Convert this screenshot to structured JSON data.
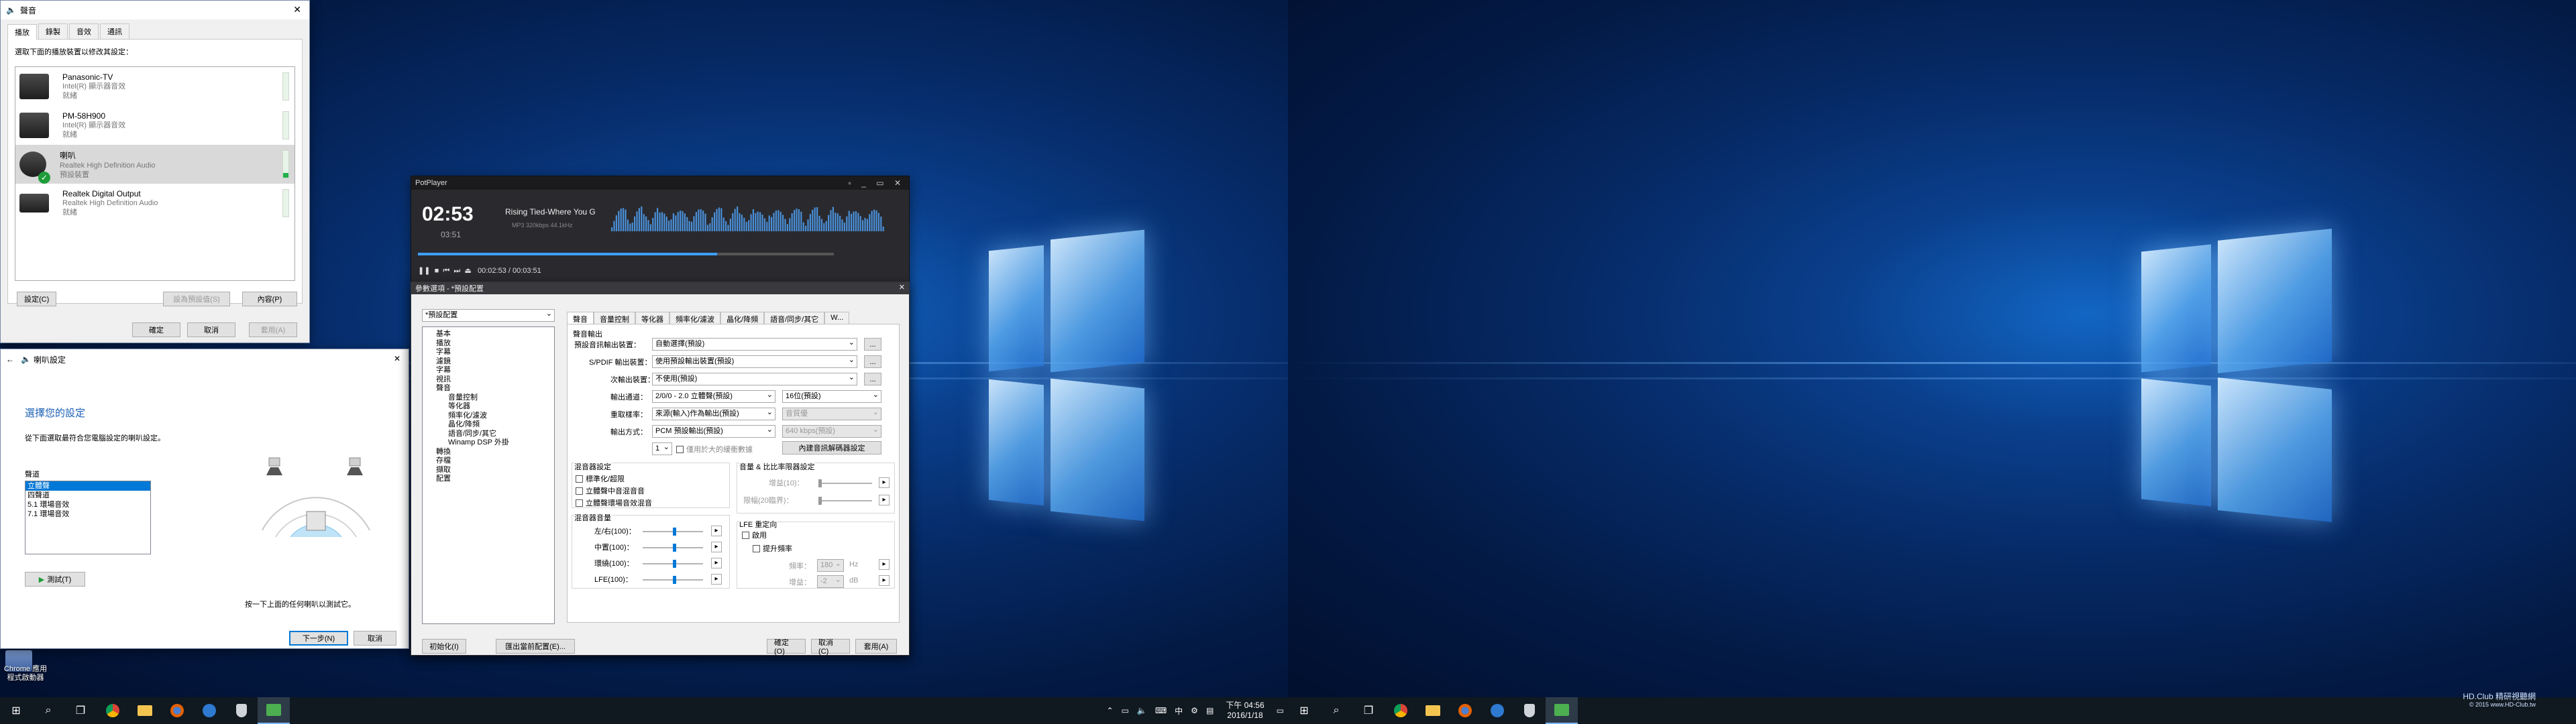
{
  "sound_dialog": {
    "title": "聲音",
    "tabs": [
      "播放",
      "錄製",
      "音效",
      "通訊"
    ],
    "instruction": "選取下面的播放裝置以修改其設定：",
    "devices": [
      {
        "name": "Panasonic-TV",
        "line1": "Intel(R) 顯示器音效",
        "line2": "就緒"
      },
      {
        "name": "PM-58H900",
        "line1": "Intel(R) 顯示器音效",
        "line2": "就緒"
      },
      {
        "name": "喇叭",
        "line1": "Realtek High Definition Audio",
        "line2": "預設裝置"
      },
      {
        "name": "Realtek Digital Output",
        "line1": "Realtek High Definition Audio",
        "line2": "就緒"
      }
    ],
    "configure_button": "設定(C)",
    "set_default_button": "設為預設值(S)",
    "properties_button": "內容(P)",
    "ok_button": "確定",
    "cancel_button": "取消",
    "apply_button": "套用(A)"
  },
  "speaker_setup": {
    "title": "喇叭設定",
    "heading": "選擇您的設定",
    "description": "從下面選取最符合您電腦設定的喇叭設定。",
    "channels_label": "聲道",
    "options": [
      "立體聲",
      "四聲道",
      "5.1 環場音效",
      "7.1 環場音效"
    ],
    "selected_index": 0,
    "test_button": "測試(T)",
    "hint": "按一下上面的任何喇叭以測試它。",
    "next_button": "下一步(N)",
    "cancel_button": "取消"
  },
  "potplayer": {
    "title": "PotPlayer",
    "elapsed": "02:53",
    "total": "03:51",
    "song_title": "Rising Tied-Where You G",
    "codec": "MP3   320kbps   44.1kHz",
    "status_time": "00:02:53 / 00:03:51",
    "seek_position": 0.72
  },
  "preferences": {
    "title": "參數選項 - *預設配置",
    "profile": "*預設配置",
    "tree": [
      {
        "label": "基本",
        "sub": false
      },
      {
        "label": "播放",
        "sub": false
      },
      {
        "label": "字幕",
        "sub": false
      },
      {
        "label": "濾鏡",
        "sub": false
      },
      {
        "label": "字幕",
        "sub": false
      },
      {
        "label": "視訊",
        "sub": false
      },
      {
        "label": "聲音",
        "sub": false
      },
      {
        "label": "音量控制",
        "sub": true
      },
      {
        "label": "等化器",
        "sub": true
      },
      {
        "label": "頻率化/濾波",
        "sub": true
      },
      {
        "label": "晶化/降頻",
        "sub": true
      },
      {
        "label": "語音/同步/其它",
        "sub": true
      },
      {
        "label": "Winamp DSP 外掛",
        "sub": true
      },
      {
        "label": "轉換",
        "sub": false
      },
      {
        "label": "存檔",
        "sub": false
      },
      {
        "label": "擷取",
        "sub": false
      },
      {
        "label": "配置",
        "sub": false
      }
    ],
    "tabs": [
      "聲音",
      "音量控制",
      "等化器",
      "頻率化/濾波",
      "晶化/降頻",
      "語音/同步/其它",
      "W..."
    ],
    "output_group": "聲音輸出",
    "default_renderer_label": "預設音訊輸出裝置：",
    "default_renderer_value": "自動選擇(預設)",
    "spdif_label": "S/PDIF 輸出裝置：",
    "spdif_value": "使用預設輸出裝置(預設)",
    "secondary_label": "次輸出裝置：",
    "secondary_value": "不使用(預設)",
    "channels_label": "輸出通道：",
    "channels_value": "2/0/0 - 2.0 立體聲(預設)",
    "bits_value": "16位(預設)",
    "samplerate_label": "重取樣率：",
    "samplerate_value": "來源(輸入)作為輸出(預設)",
    "samplerate_extra": "音質優",
    "format_label": "輸出方式：",
    "format_value": "PCM 預設輸出(預設)",
    "format_extra": "640 kbps(預設)",
    "buffer_value": "1",
    "buffer_check": "僅用於大的緩衝數據",
    "builtin_settings_button": "內建音訊解碼器設定",
    "mixer_group": "混音器設定",
    "mixer_checks": [
      "標準化/超限",
      "立體聲中音混音音",
      "立體聲環場音效混音"
    ],
    "levels_group": "混音器音量",
    "levels": [
      {
        "label": "左/右(100)：",
        "value": 100
      },
      {
        "label": "中置(100)：",
        "value": 100
      },
      {
        "label": "環繞(100)：",
        "value": 100
      },
      {
        "label": "LFE(100)：",
        "value": 100
      }
    ],
    "volume_group": "音量 & 比比率限器設定",
    "gain_label": "增益(10)：",
    "limit_label": "限幅(20臨界)：",
    "lfe_group": "LFE 重定向",
    "lfe_enable": "啟用",
    "lfe_boost": "提升頻率",
    "cutoff_label": "頻率：",
    "cutoff_value": "180",
    "cutoff_unit": "Hz",
    "gain2_label": "增益：",
    "gain2_value": "-2",
    "gain2_unit": "dB",
    "init_button": "初始化(I)",
    "export_button": "匯出當前配置(E)...",
    "ok_button": "確定(O)",
    "cancel_button": "取消(C)",
    "apply_button": "套用(A)"
  },
  "taskbar": {
    "time": "下午 04:56",
    "date": "2016/1/18"
  },
  "desktop": {
    "icon_label_1": "Chrome 應用",
    "icon_label_2": "程式啟動器",
    "watermark_1": "HD.Club 精研視聽網",
    "watermark_2": "© 2015  www.HD-Club.tw"
  }
}
